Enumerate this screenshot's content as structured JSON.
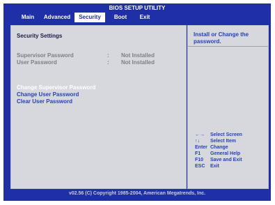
{
  "title": "BIOS SETUP UTILITY",
  "menu": [
    {
      "label": "Main"
    },
    {
      "label": "Advanced"
    },
    {
      "label": "Security"
    },
    {
      "label": "Boot"
    },
    {
      "label": "Exit"
    }
  ],
  "active_tab": "Security",
  "main": {
    "section_title": "Security Settings",
    "rows": [
      {
        "label": "Supervisor Password",
        "sep": ":",
        "value": "Not Installed"
      },
      {
        "label": "User Password",
        "sep": ":",
        "value": "Not Installed"
      }
    ],
    "actions": [
      {
        "label": "Change Supervisor Password"
      },
      {
        "label": "Change User Password"
      },
      {
        "label": "Clear User Password"
      }
    ]
  },
  "help": {
    "text": "Install or Change the password.",
    "keys": [
      {
        "key": "←→",
        "desc": "Select Screen"
      },
      {
        "key": "↑↓",
        "desc": "Select Item"
      },
      {
        "key": "Enter",
        "desc": "Change"
      },
      {
        "key": "F1",
        "desc": "General Help"
      },
      {
        "key": "F10",
        "desc": "Save and Exit"
      },
      {
        "key": "ESC",
        "desc": "Exit"
      }
    ]
  },
  "footer": "v02.56 (C) Copyright  1985-2004, American Megatrends, Inc.",
  "colors": {
    "background": "#1e2fa8",
    "panel": "#d6d8de",
    "accent_text": "#2740b9",
    "selected_text": "#ffffff"
  }
}
